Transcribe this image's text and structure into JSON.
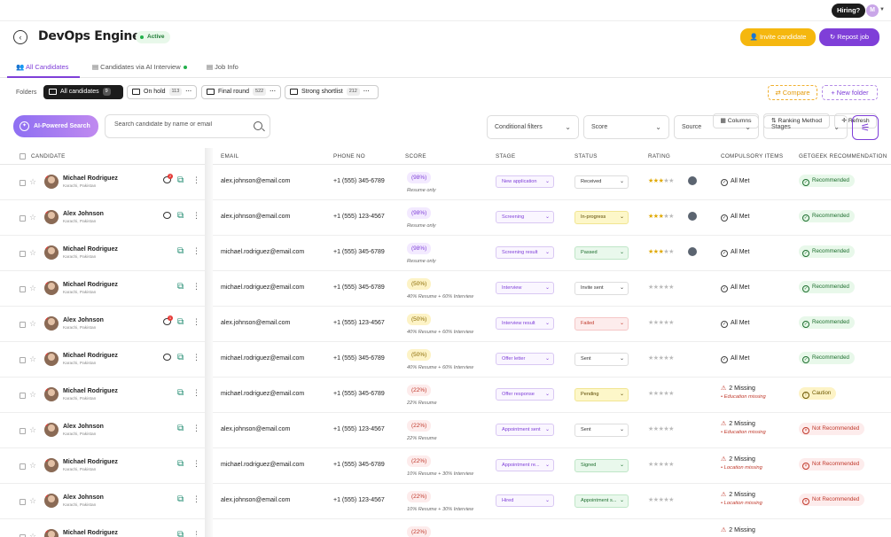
{
  "topbar": {
    "hiring_label": "Hiring?",
    "user_initial": "M"
  },
  "header": {
    "title": "DevOps Engineer",
    "status": "Active",
    "invite_label": "Invite candidate",
    "repost_label": "Repost job"
  },
  "tabs": [
    {
      "label": "All Candidates"
    },
    {
      "label": "Candidates via AI Interview"
    },
    {
      "label": "Job Info"
    }
  ],
  "toolbar": {
    "columns": "Columns",
    "ranking": "Ranking Method",
    "refresh": "Refresh"
  },
  "folders": {
    "label": "Folders",
    "items": [
      {
        "name": "All candidates",
        "count": "9"
      },
      {
        "name": "On hold",
        "count": "113"
      },
      {
        "name": "Final round",
        "count": "522"
      },
      {
        "name": "Strong shortlist",
        "count": "212"
      }
    ],
    "compare": "Compare",
    "new_folder": "New folder"
  },
  "search": {
    "ai_label": "AI-Powered Search",
    "placeholder": "Search candidate by name or email",
    "filters": [
      "Conditional filters",
      "Score",
      "Source",
      "Stages"
    ]
  },
  "columns": [
    "CANDIDATE",
    "EMAIL",
    "PHONE NO",
    "SCORE",
    "STAGE",
    "STATUS",
    "RATING",
    "COMPULSORY ITEMS",
    "GETGEEK RECOMMENDATION"
  ],
  "rows": [
    {
      "name": "Michael Rodriguez",
      "loc": "Karachi, Pakistan",
      "msg": "2",
      "email": "alex.johnson@email.com",
      "phone": "+1 (555) 345-6789",
      "score": "(98%)",
      "score_sub": "Resume only",
      "stage": "New application",
      "status": "Received",
      "rating": 3,
      "comp": "All Met",
      "rec": "Recommended"
    },
    {
      "name": "Alex Johnson",
      "loc": "Karachi, Pakistan",
      "msg": "",
      "email": "alex.johnson@email.com",
      "phone": "+1 (555) 123-4567",
      "score": "(98%)",
      "score_sub": "Resume only",
      "stage": "Screening",
      "status": "In-progress",
      "rating": 3,
      "comp": "All Met",
      "rec": "Recommended"
    },
    {
      "name": "Michael Rodriguez",
      "loc": "Karachi, Pakistan",
      "msg": null,
      "email": "michael.rodriguez@email.com",
      "phone": "+1 (555) 345-6789",
      "score": "(98%)",
      "score_sub": "Resume only",
      "stage": "Screening result",
      "status": "Passed",
      "rating": 3,
      "comp": "All Met",
      "rec": "Recommended"
    },
    {
      "name": "Michael Rodriguez",
      "loc": "Karachi, Pakistan",
      "msg": null,
      "email": "michael.rodriguez@email.com",
      "phone": "+1 (555) 345-6789",
      "score": "(50%)",
      "score_sub": "40% Resume + 60% Interview",
      "stage": "Interview",
      "status": "Invite sent",
      "rating": 0,
      "comp": "All Met",
      "rec": "Recommended"
    },
    {
      "name": "Alex Johnson",
      "loc": "Karachi, Pakistan",
      "msg": "1",
      "email": "alex.johnson@email.com",
      "phone": "+1 (555) 123-4567",
      "score": "(50%)",
      "score_sub": "40% Resume + 60% Interview",
      "stage": "Interview result",
      "status": "Failed",
      "rating": 0,
      "comp": "All Met",
      "rec": "Recommended"
    },
    {
      "name": "Michael Rodriguez",
      "loc": "Karachi, Pakistan",
      "msg": "",
      "email": "michael.rodriguez@email.com",
      "phone": "+1 (555) 345-6789",
      "score": "(50%)",
      "score_sub": "40% Resume + 60% Interview",
      "stage": "Offer letter",
      "status": "Sent",
      "rating": 0,
      "comp": "All Met",
      "rec": "Recommended"
    },
    {
      "name": "Michael Rodriguez",
      "loc": "Karachi, Pakistan",
      "msg": null,
      "email": "michael.rodriguez@email.com",
      "phone": "+1 (555) 345-6789",
      "score": "(22%)",
      "score_sub": "22% Resume",
      "stage": "Offer response",
      "status": "Pending",
      "rating": 0,
      "comp": "2 Missing",
      "comp_sub": "• Education missing",
      "rec": "Caution"
    },
    {
      "name": "Alex Johnson",
      "loc": "Karachi, Pakistan",
      "msg": null,
      "email": "alex.johnson@email.com",
      "phone": "+1 (555) 123-4567",
      "score": "(22%)",
      "score_sub": "22% Resume",
      "stage": "Appointment sent",
      "status": "Sent",
      "rating": 0,
      "comp": "2 Missing",
      "comp_sub": "• Education missing",
      "rec": "Not Recommended"
    },
    {
      "name": "Michael Rodriguez",
      "loc": "Karachi, Pakistan",
      "msg": null,
      "email": "michael.rodriguez@email.com",
      "phone": "+1 (555) 345-6789",
      "score": "(22%)",
      "score_sub": "10% Resume + 30% Interview",
      "stage": "Appointment re...",
      "status": "Signed",
      "rating": 0,
      "comp": "2 Missing",
      "comp_sub": "• Location missing",
      "rec": "Not Recommended"
    },
    {
      "name": "Alex Johnson",
      "loc": "Karachi, Pakistan",
      "msg": null,
      "email": "alex.johnson@email.com",
      "phone": "+1 (555) 123-4567",
      "score": "(22%)",
      "score_sub": "10% Resume + 30% Interview",
      "stage": "Hired",
      "status": "Appointment s...",
      "rating": 0,
      "comp": "2 Missing",
      "comp_sub": "• Location missing",
      "rec": "Not Recommended"
    },
    {
      "name": "Michael Rodriguez",
      "loc": "Karachi, Pakistan",
      "msg": null,
      "email": "",
      "phone": "",
      "score": "(22%)",
      "score_sub": "",
      "stage": "",
      "status": "",
      "rating": 0,
      "comp": "2 Missing",
      "comp_sub": "",
      "rec": ""
    }
  ],
  "colors": {
    "accent": "#7f3fd8",
    "warning": "#f5b70f",
    "success": "#22b04b",
    "danger": "#e53935"
  }
}
